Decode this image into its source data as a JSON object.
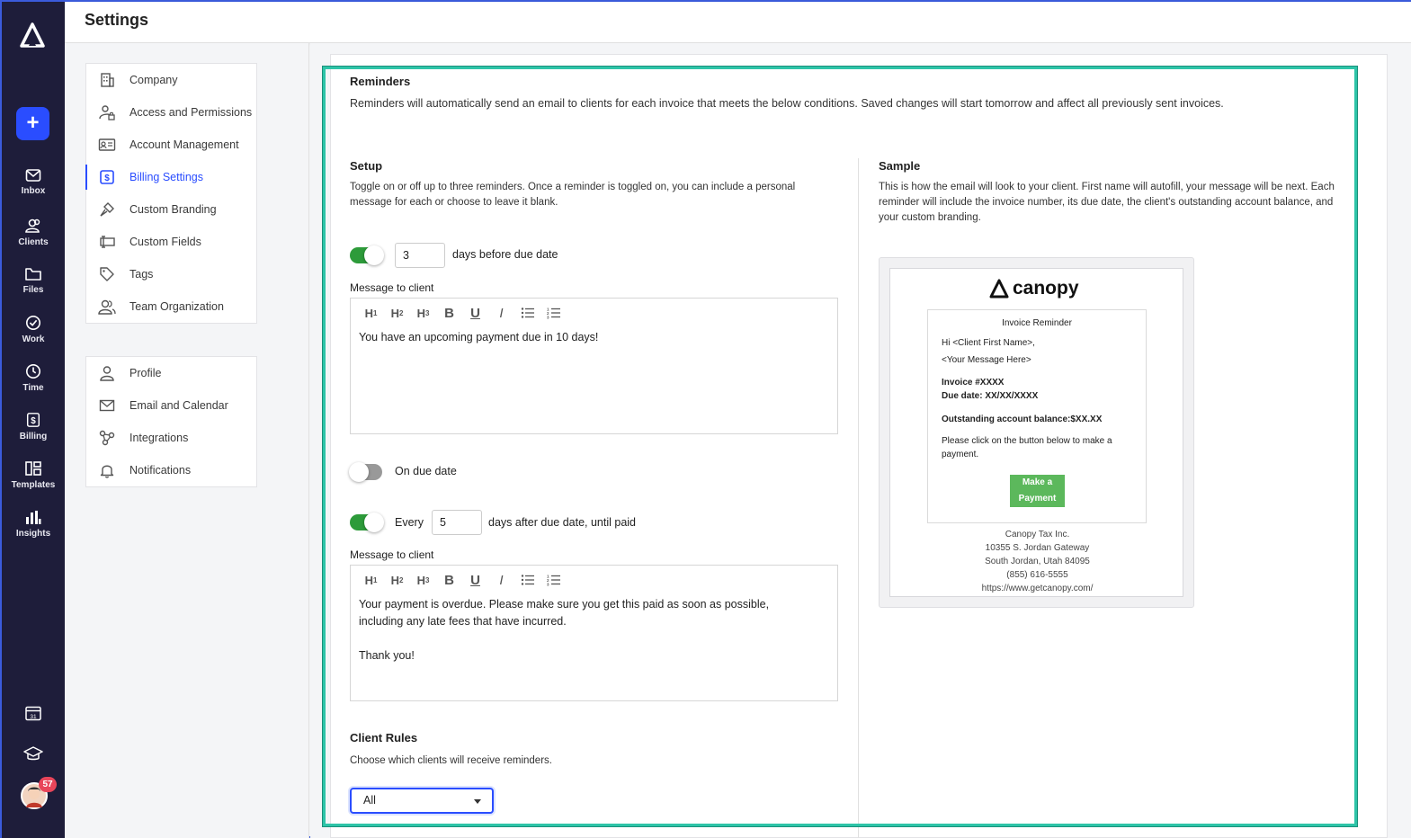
{
  "header": {
    "title": "Settings"
  },
  "rail": {
    "items": [
      {
        "label": "Inbox",
        "icon": "mail-icon"
      },
      {
        "label": "Clients",
        "icon": "people-icon"
      },
      {
        "label": "Files",
        "icon": "folder-icon"
      },
      {
        "label": "Work",
        "icon": "check-circle-icon"
      },
      {
        "label": "Time",
        "icon": "clock-icon"
      },
      {
        "label": "Billing",
        "icon": "dollar-icon"
      },
      {
        "label": "Templates",
        "icon": "templates-icon"
      },
      {
        "label": "Insights",
        "icon": "bar-chart-icon"
      }
    ],
    "avatar_badge": "57"
  },
  "nav": {
    "group1": [
      {
        "label": "Company",
        "icon": "building-icon"
      },
      {
        "label": "Access and Permissions",
        "icon": "user-lock-icon"
      },
      {
        "label": "Account Management",
        "icon": "id-card-icon"
      },
      {
        "label": "Billing Settings",
        "icon": "dollar-square-icon"
      },
      {
        "label": "Custom Branding",
        "icon": "brush-icon"
      },
      {
        "label": "Custom Fields",
        "icon": "fields-icon"
      },
      {
        "label": "Tags",
        "icon": "tag-icon"
      },
      {
        "label": "Team Organization",
        "icon": "team-icon"
      }
    ],
    "group2": [
      {
        "label": "Profile",
        "icon": "person-icon"
      },
      {
        "label": "Email and Calendar",
        "icon": "envelope-icon"
      },
      {
        "label": "Integrations",
        "icon": "integrations-icon"
      },
      {
        "label": "Notifications",
        "icon": "bell-icon"
      }
    ],
    "active": "Billing Settings"
  },
  "reminders": {
    "title": "Reminders",
    "description": "Reminders will automatically send an email to clients for each invoice that meets the below conditions. Saved changes will start tomorrow and affect all previously sent invoices."
  },
  "setup": {
    "title": "Setup",
    "description": "Toggle on or off up to three reminders. Once a reminder is toggled on, you can include a personal message for each or choose to leave it blank.",
    "reminder1": {
      "on": true,
      "days": "3",
      "suffix": "days before due date",
      "message_label": "Message to client",
      "message": "You have an upcoming payment due in 10 days!"
    },
    "reminder2": {
      "on": false,
      "label": "On due date"
    },
    "reminder3": {
      "on": true,
      "prefix": "Every",
      "days": "5",
      "suffix": "days after due date, until paid",
      "message_label": "Message to client",
      "message": "Your payment is overdue. Please make sure you get this paid as soon as possible,\nincluding any late fees that have incurred.\n\nThank you!"
    },
    "toolbar": [
      "H1",
      "H2",
      "H3",
      "B",
      "U",
      "I",
      "bullet-list",
      "numbered-list"
    ]
  },
  "client_rules": {
    "title": "Client Rules",
    "description": "Choose which clients will receive reminders.",
    "selected": "All"
  },
  "sample": {
    "title": "Sample",
    "description": "This is how the email will look to your client. First name will autofill, your message will be next. Each reminder will include the invoice number, its due date, the client's outstanding account balance, and your custom branding.",
    "brand": "canopy",
    "email_title": "Invoice Reminder",
    "greeting": "Hi <Client First Name>,",
    "message_placeholder": "<Your Message Here>",
    "invoice": "Invoice #XXXX",
    "due": "Due date: XX/XX/XXXX",
    "balance": "Outstanding account balance:$XX.XX",
    "instruction": "Please click on the button below to make a payment.",
    "button": "Make a Payment",
    "footer": [
      "Canopy Tax Inc.",
      "10355 S. Jordan Gateway",
      "South Jordan, Utah 84095",
      "(855) 616-5555",
      "https://www.getcanopy.com/"
    ]
  },
  "colors": {
    "rail": "#1e1d3a",
    "accent": "#2a4dff",
    "toggle_on": "#2d9b3a",
    "highlight": "#2ec4a8",
    "pay_button": "#5cb85c"
  }
}
